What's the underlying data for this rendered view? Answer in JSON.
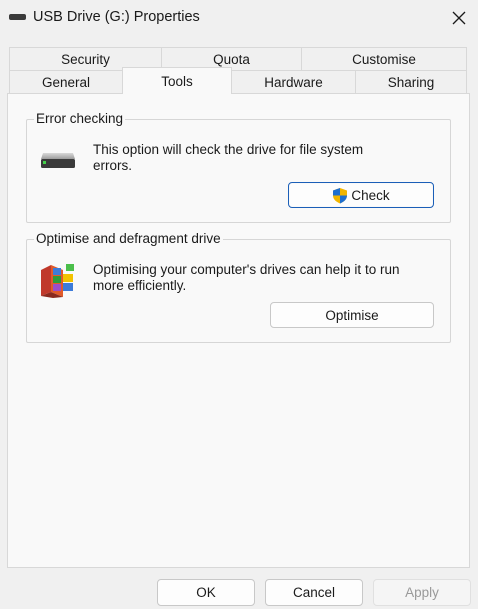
{
  "window": {
    "title": "USB Drive (G:) Properties",
    "icon": "drive-icon",
    "close_icon": "close-icon"
  },
  "tabs": {
    "row1": [
      {
        "label": "Security"
      },
      {
        "label": "Quota"
      },
      {
        "label": "Customise"
      }
    ],
    "row2": [
      {
        "label": "General"
      },
      {
        "label": "Tools",
        "active": true
      },
      {
        "label": "Hardware"
      },
      {
        "label": "Sharing"
      }
    ]
  },
  "error_checking": {
    "legend": "Error checking",
    "description_line1": "This option will check the drive for file system",
    "description_line2": "errors.",
    "icon": "hard-drive-icon",
    "button_label": "Check",
    "button_icon": "uac-shield-icon"
  },
  "optimise": {
    "legend": "Optimise and defragment drive",
    "description_line1": "Optimising your computer's drives can help it to run",
    "description_line2": "more efficiently.",
    "icon": "defragment-icon",
    "button_label": "Optimise"
  },
  "footer": {
    "ok_label": "OK",
    "cancel_label": "Cancel",
    "apply_label": "Apply"
  },
  "colors": {
    "window_bg": "#f0f0f0",
    "panel_bg": "#f9f9f9",
    "accent_border": "#1b5fb8",
    "disabled_text": "#9a9a9a"
  }
}
